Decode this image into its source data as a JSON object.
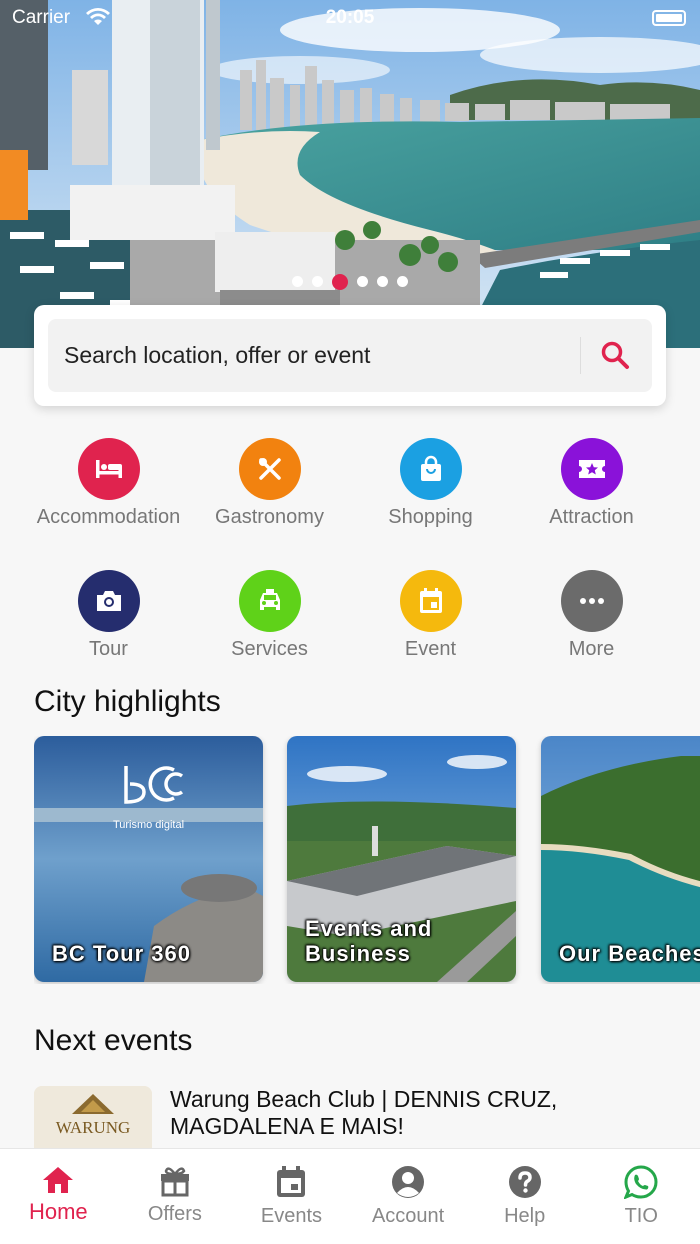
{
  "status_bar": {
    "carrier": "Carrier",
    "time": "20:05"
  },
  "hero": {
    "slides": 6,
    "active_slide": 3
  },
  "search": {
    "placeholder": "Search location, offer or event"
  },
  "categories": [
    {
      "label": "Accommodation",
      "icon": "bed-icon",
      "color": "#e0234e"
    },
    {
      "label": "Gastronomy",
      "icon": "cutlery-icon",
      "color": "#f2820f"
    },
    {
      "label": "Shopping",
      "icon": "shopping-bag-icon",
      "color": "#1ba0e2"
    },
    {
      "label": "Attraction",
      "icon": "ticket-star-icon",
      "color": "#8a12d9"
    },
    {
      "label": "Tour",
      "icon": "camera-icon",
      "color": "#252d6e"
    },
    {
      "label": "Services",
      "icon": "taxi-icon",
      "color": "#5fd219"
    },
    {
      "label": "Event",
      "icon": "calendar-icon",
      "color": "#f5b90d"
    },
    {
      "label": "More",
      "icon": "more-dots-icon",
      "color": "#6b6b6b"
    }
  ],
  "highlights": {
    "title": "City highlights",
    "items": [
      {
        "label": "BC Tour 360",
        "logo_text": "Turismo digital"
      },
      {
        "label": "Events and Business"
      },
      {
        "label": "Our Beaches"
      }
    ]
  },
  "events": {
    "title": "Next events",
    "items": [
      {
        "title": "Warung Beach Club | DENNIS CRUZ, MAGDALENA E MAIS!",
        "thumb_text": "WARUNG"
      }
    ]
  },
  "tabbar": {
    "active": "Home",
    "accent": "#e0234e",
    "tabs": [
      {
        "label": "Home",
        "icon": "home-icon"
      },
      {
        "label": "Offers",
        "icon": "gift-icon"
      },
      {
        "label": "Events",
        "icon": "calendar-icon"
      },
      {
        "label": "Account",
        "icon": "account-icon"
      },
      {
        "label": "Help",
        "icon": "help-icon"
      },
      {
        "label": "TIO",
        "icon": "whatsapp-icon"
      }
    ]
  }
}
